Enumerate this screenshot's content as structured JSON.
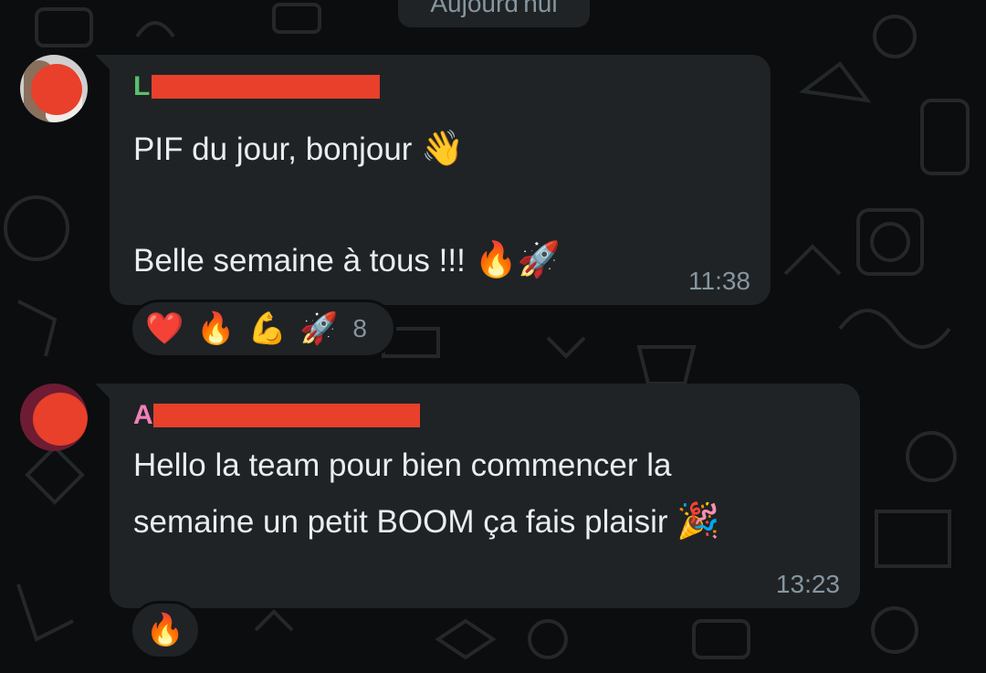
{
  "date_chip": "Aujourd'hui",
  "messages": [
    {
      "sender": "L",
      "line1": "PIF du jour, bonjour ",
      "line1_emoji": "👋",
      "line2": "Belle semaine à tous !!! ",
      "line2_emoji": "🔥🚀",
      "time": "11:38",
      "reactions": [
        "❤️",
        "🔥",
        "💪",
        "🚀"
      ],
      "reaction_count": "8"
    },
    {
      "sender": "A",
      "line1": "Hello la team pour bien commencer la",
      "line2": "semaine un petit BOOM ça fais plaisir ",
      "line2_emoji": "🎉",
      "time": "13:23",
      "reactions": [
        "🔥"
      ]
    }
  ],
  "colors": {
    "background": "#0b0d0e",
    "bubble": "#1f2326",
    "sender1": "#5ac06b",
    "sender2": "#f281b7",
    "redaction": "#e8402a",
    "meta_text": "#8696a0"
  }
}
